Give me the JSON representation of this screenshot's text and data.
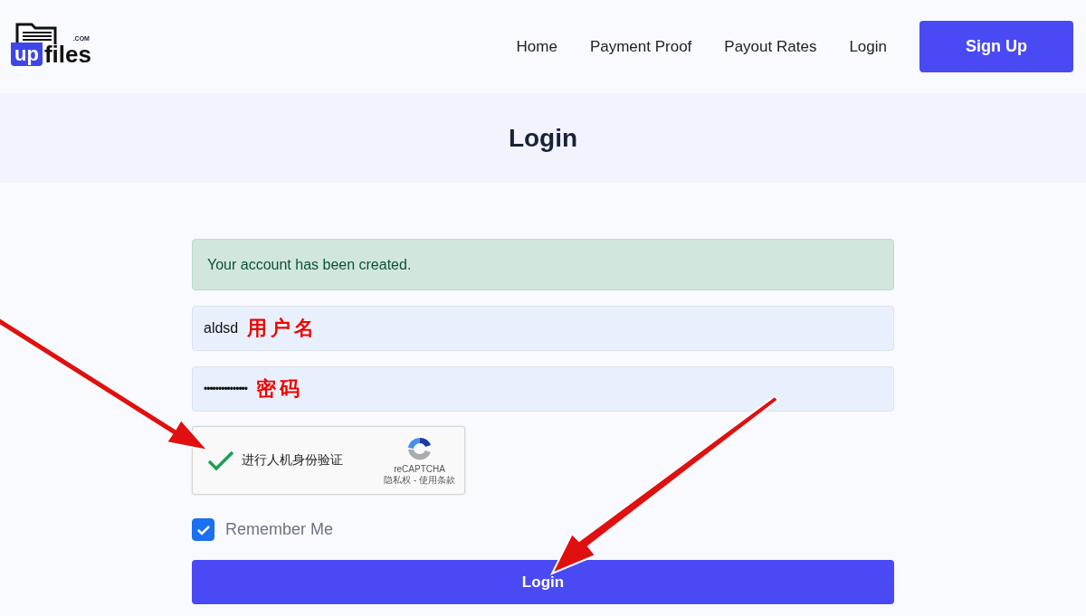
{
  "header": {
    "logo": {
      "badge": "up",
      "word": "files",
      "tld": ".COM"
    },
    "nav": [
      {
        "label": "Home"
      },
      {
        "label": "Payment Proof"
      },
      {
        "label": "Payout Rates"
      },
      {
        "label": "Login"
      }
    ],
    "signup_button": "Sign Up"
  },
  "page_title": "Login",
  "alert": "Your account has been created.",
  "fields": [
    {
      "kind": "text",
      "value": "aldsd",
      "annotation": "用户名"
    },
    {
      "kind": "password",
      "value": "•••••••••••••••",
      "annotation": "密码"
    }
  ],
  "captcha": {
    "checked": true,
    "label": "进行人机身份验证",
    "brand": "reCAPTCHA",
    "links": "隐私权 - 使用条款"
  },
  "remember": {
    "label": "Remember Me",
    "checked": true
  },
  "login_button": "Login"
}
